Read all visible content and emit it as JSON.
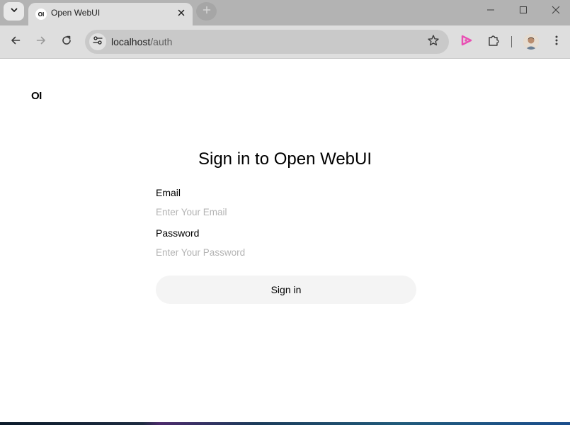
{
  "browser": {
    "tab": {
      "title": "Open WebUI",
      "favicon_text": "OI"
    },
    "address": {
      "host": "localhost",
      "path": "/auth"
    },
    "icons": {
      "tab_search": "chevron-down-icon",
      "tab_close": "close-icon",
      "new_tab": "plus-icon",
      "minimize": "minimize-icon",
      "maximize": "maximize-icon",
      "window_close": "close-icon",
      "back": "arrow-left-icon",
      "forward": "arrow-right-icon",
      "reload": "reload-icon",
      "site_info": "tune-icon",
      "bookmark": "star-icon",
      "extension_pink": "play-icon",
      "extensions": "puzzle-icon",
      "menu": "kebab-menu-icon"
    }
  },
  "page": {
    "logo": "OI",
    "title": "Sign in to Open WebUI",
    "email": {
      "label": "Email",
      "placeholder": "Enter Your Email",
      "value": ""
    },
    "password": {
      "label": "Password",
      "placeholder": "Enter Your Password",
      "value": ""
    },
    "submit_label": "Sign in"
  },
  "colors": {
    "tabstrip": "#b3b3b3",
    "toolbar": "#dedede",
    "button_bg": "#f4f4f4",
    "placeholder": "#b4b4b4",
    "extension_accent": "#e94fb3"
  }
}
